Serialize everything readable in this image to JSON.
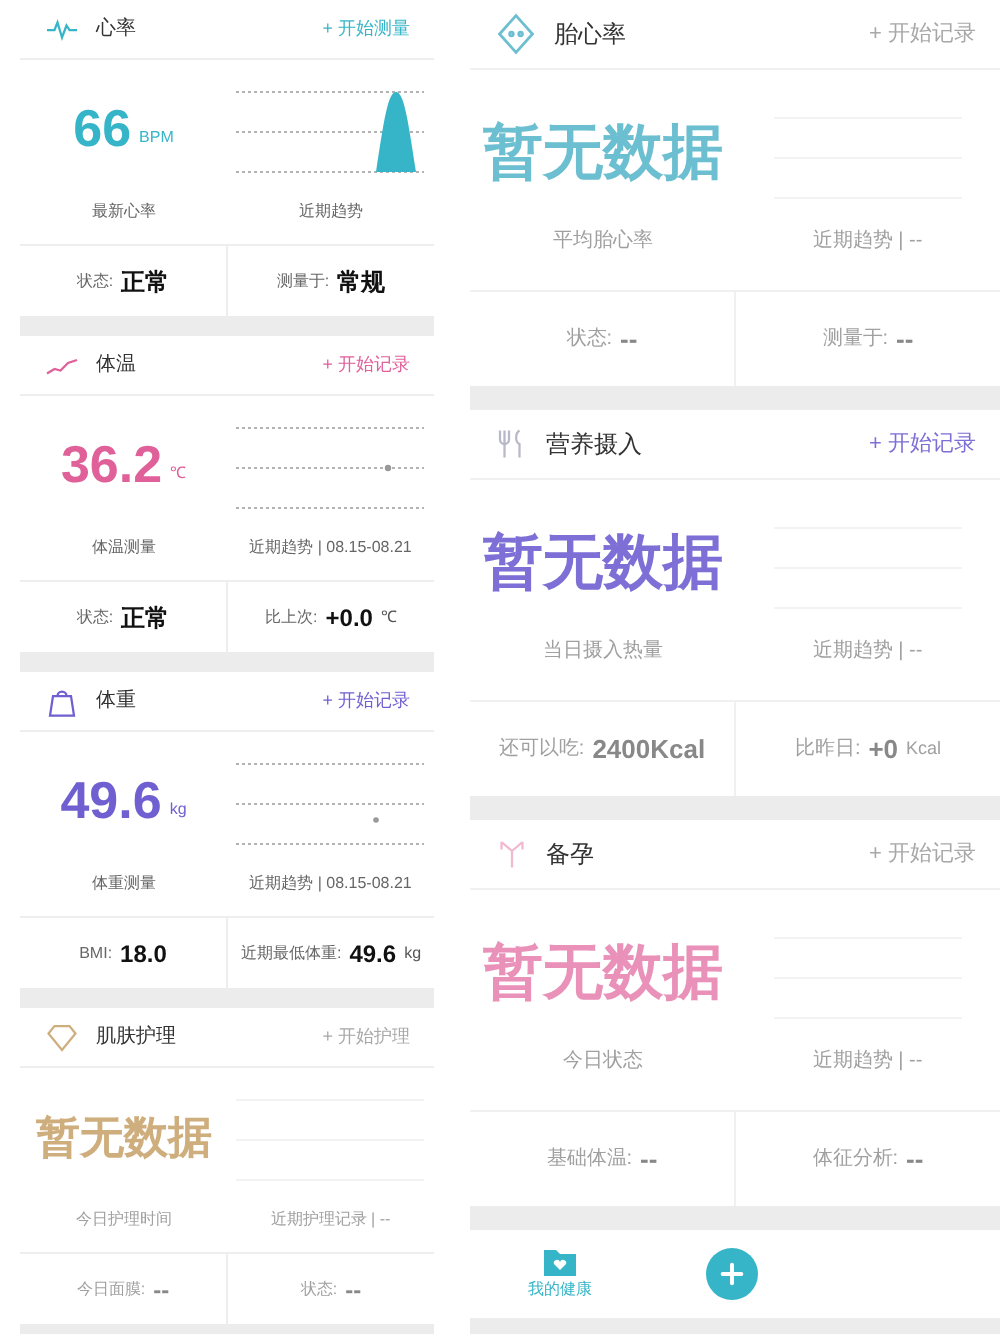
{
  "left_column": {
    "cards": [
      {
        "kind": "pulse",
        "title": "心率",
        "color": "#36b5c9",
        "action": {
          "label": "+ 开始测量",
          "disabled": false
        },
        "value": "66",
        "unit": "BPM",
        "value_label": "最新心率",
        "trend_label": "近期趋势",
        "footer": [
          {
            "label": "状态:",
            "value": "正常"
          },
          {
            "label": "测量于:",
            "value": "常规"
          }
        ]
      },
      {
        "kind": "thermo",
        "title": "体温",
        "color": "#e0609a",
        "action": {
          "label": "+ 开始记录",
          "disabled": false
        },
        "value": "36.2",
        "unit": "℃",
        "value_label": "体温测量",
        "trend_label": "近期趋势 | 08.15-08.21",
        "footer": [
          {
            "label": "状态:",
            "value": "正常"
          },
          {
            "label": "比上次:",
            "value": "+0.0",
            "unit": "℃"
          }
        ]
      },
      {
        "kind": "scale",
        "title": "体重",
        "color": "#6f5fd0",
        "action": {
          "label": "+ 开始记录",
          "disabled": false
        },
        "value": "49.6",
        "unit": "kg",
        "value_label": "体重测量",
        "trend_label": "近期趋势 | 08.15-08.21",
        "footer": [
          {
            "label": "BMI:",
            "value": "18.0"
          },
          {
            "label": "近期最低体重:",
            "value": "49.6",
            "unit": "kg"
          }
        ]
      },
      {
        "kind": "skin",
        "title": "肌肤护理",
        "color": "#cfae7e",
        "action": {
          "label": "+ 开始护理",
          "disabled": true
        },
        "no_data": "暂无数据",
        "value_label": "今日护理时间",
        "trend_label": "近期护理记录 | --",
        "footer": [
          {
            "label": "今日面膜:",
            "value": "--"
          },
          {
            "label": "状态:",
            "value": "--"
          }
        ]
      }
    ]
  },
  "right_column": {
    "cards": [
      {
        "kind": "fetal",
        "title": "胎心率",
        "color": "#6cbfd0",
        "action": {
          "label": "+ 开始记录",
          "disabled": true
        },
        "no_data": "暂无数据",
        "value_label": "平均胎心率",
        "trend_label": "近期趋势 | --",
        "footer": [
          {
            "label": "状态:",
            "value": "--"
          },
          {
            "label": "测量于:",
            "value": "--"
          }
        ]
      },
      {
        "kind": "food",
        "title": "营养摄入",
        "color": "#7e6fd6",
        "action": {
          "label": "+ 开始记录",
          "disabled": false
        },
        "no_data": "暂无数据",
        "value_label": "当日摄入热量",
        "trend_label": "近期趋势 | --",
        "footer": [
          {
            "label": "还可以吃:",
            "value": "2400Kcal"
          },
          {
            "label": "比昨日:",
            "value": "+0",
            "unit": "Kcal"
          }
        ]
      },
      {
        "kind": "fertility",
        "title": "备孕",
        "color": "#e991b9",
        "action": {
          "label": "+ 开始记录",
          "disabled": true
        },
        "no_data": "暂无数据",
        "value_label": "今日状态",
        "trend_label": "近期趋势 | --",
        "footer": [
          {
            "label": "基础体温:",
            "value": "--"
          },
          {
            "label": "体征分析:",
            "value": "--"
          }
        ]
      }
    ]
  },
  "tab_bar": {
    "tabs": [
      {
        "label": "我的健康",
        "selected": true
      }
    ]
  }
}
